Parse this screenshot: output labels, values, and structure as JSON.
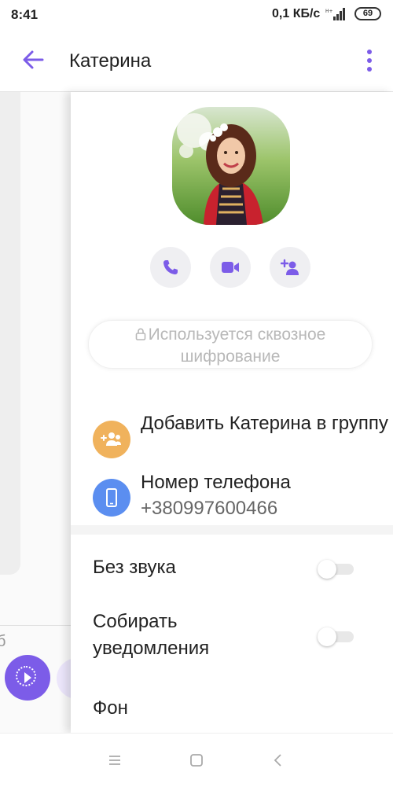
{
  "status_bar": {
    "time": "8:41",
    "speed": "0,1 КБ/с",
    "battery": "69"
  },
  "header": {
    "title": "Катерина",
    "accent_color": "#7c5ce8"
  },
  "contact_panel": {
    "actions": [
      {
        "icon": "phone-icon"
      },
      {
        "icon": "video-camera-icon"
      },
      {
        "icon": "add-participant-icon"
      }
    ],
    "encryption_notice": "Используется сквозное шифрование",
    "add_to_group": {
      "label": "Добавить Катерина в группу",
      "icon": "group-add-icon",
      "icon_color": "#f0b25c"
    },
    "phone": {
      "label": "Номер телефона",
      "value": "+380997600466",
      "icon": "smartphone-icon",
      "icon_color": "#5b8ef0"
    },
    "settings": {
      "mute": {
        "label": "Без звука",
        "enabled": false
      },
      "collect_notifications": {
        "label": "Собирать уведомления",
        "enabled": false
      },
      "background": {
        "label": "Фон"
      }
    }
  },
  "chat_strip": {
    "edge_char": "б"
  }
}
